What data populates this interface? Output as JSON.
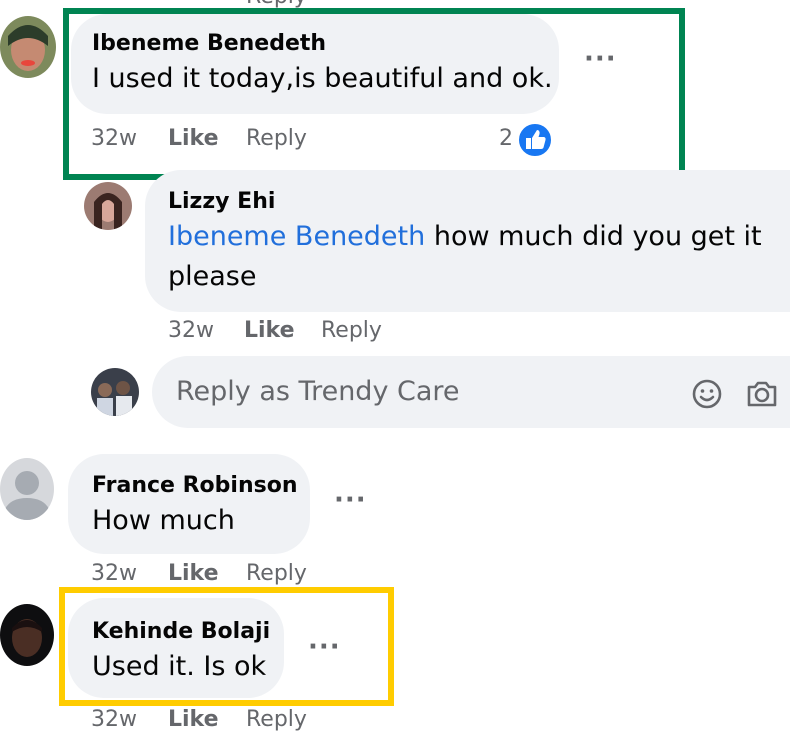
{
  "colors": {
    "highlight_green": "#008452",
    "highlight_yellow": "#ffcc00",
    "mention": "#216fdb",
    "like_badge": "#1877f2"
  },
  "top_cut": {
    "reply_label": "Reply"
  },
  "comments": [
    {
      "author": "Ibeneme Benedeth",
      "text": "I used it today,is beautiful and ok.",
      "time": "32w",
      "like_label": "Like",
      "reply_label": "Reply",
      "reactions_count": "2",
      "reaction_icon": "like-thumb-icon",
      "more_icon": "more-dots-icon",
      "highlight": "green"
    },
    {
      "author": "Lizzy Ehi",
      "mention": "Ibeneme Benedeth",
      "text_line1": " how much did you get it",
      "text_line2": "please",
      "time": "32w",
      "like_label": "Like",
      "reply_label": "Reply"
    },
    {
      "author": "France Robinson",
      "text": "How much",
      "time": "32w",
      "like_label": "Like",
      "reply_label": "Reply",
      "more_icon": "more-dots-icon",
      "avatar_icon": "default-profile-icon"
    },
    {
      "author": "Kehinde Bolaji",
      "text": "Used it. Is ok",
      "time": "32w",
      "like_label": "Like",
      "reply_label": "Reply",
      "more_icon": "more-dots-icon",
      "highlight": "yellow"
    }
  ],
  "reply_box": {
    "placeholder": "Reply as Trendy Care",
    "emoji_icon": "emoji-icon",
    "camera_icon": "camera-icon"
  }
}
